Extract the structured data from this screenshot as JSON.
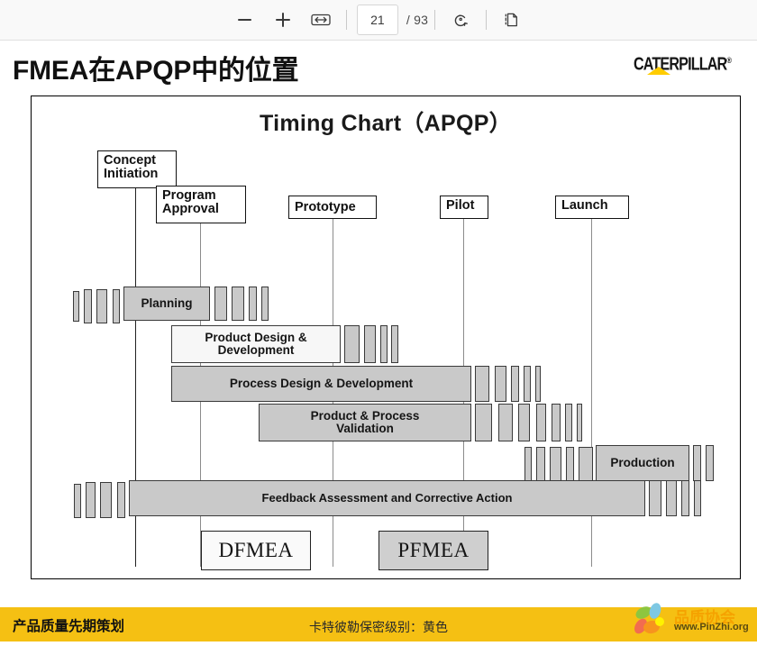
{
  "viewer": {
    "zoom_out_label": "−",
    "zoom_in_label": "+",
    "fit_label": "↔",
    "current_page": "21",
    "page_total": "/ 93",
    "rotate_label": "rotate",
    "page_view_label": "page-view"
  },
  "slide": {
    "title": "FMEA在APQP中的位置",
    "logo": {
      "wordmark": "CATERPILLAR",
      "registered": "®",
      "triangle_color": "#FFCC00"
    }
  },
  "chart_data": {
    "type": "bar",
    "title": "Timing Chart（APQP）",
    "xlabel": "",
    "ylabel": "",
    "orientation": "horizontal-gantt",
    "milestones": [
      {
        "label": "Concept\nInitiation",
        "x_pct": 14.7
      },
      {
        "label": "Program\nApproval",
        "x_pct": 23.8
      },
      {
        "label": "Prototype",
        "x_pct": 42.4
      },
      {
        "label": "Pilot",
        "x_pct": 60.8
      },
      {
        "label": "Launch",
        "x_pct": 78.8
      }
    ],
    "phases": [
      {
        "name": "Planning",
        "start_pct": 13.0,
        "end_pct": 25.5,
        "fill": "gray"
      },
      {
        "name": "Product Design &\nDevelopment",
        "start_pct": 19.3,
        "end_pct": 43.0,
        "fill": "light"
      },
      {
        "name": "Process Design & Development",
        "start_pct": 19.3,
        "end_pct": 61.6,
        "fill": "gray"
      },
      {
        "name": "Product & Process\nValidation",
        "start_pct": 32.0,
        "end_pct": 61.6,
        "fill": "gray"
      },
      {
        "name": "Production",
        "start_pct": 82.8,
        "end_pct": 96.3,
        "fill": "gray"
      },
      {
        "name": "Feedback Assessment and Corrective Action",
        "start_pct": 13.0,
        "end_pct": 90.1,
        "fill": "gray"
      }
    ],
    "fmea_markers": [
      {
        "label": "DFMEA",
        "fill": "light"
      },
      {
        "label": "PFMEA",
        "fill": "gray"
      }
    ]
  },
  "footer": {
    "left_text": "产品质量先期策划",
    "center_text": "卡特彼勒保密级别：黄色",
    "watermark_name": "品质协会",
    "watermark_url": "www.PinZhi.org"
  }
}
